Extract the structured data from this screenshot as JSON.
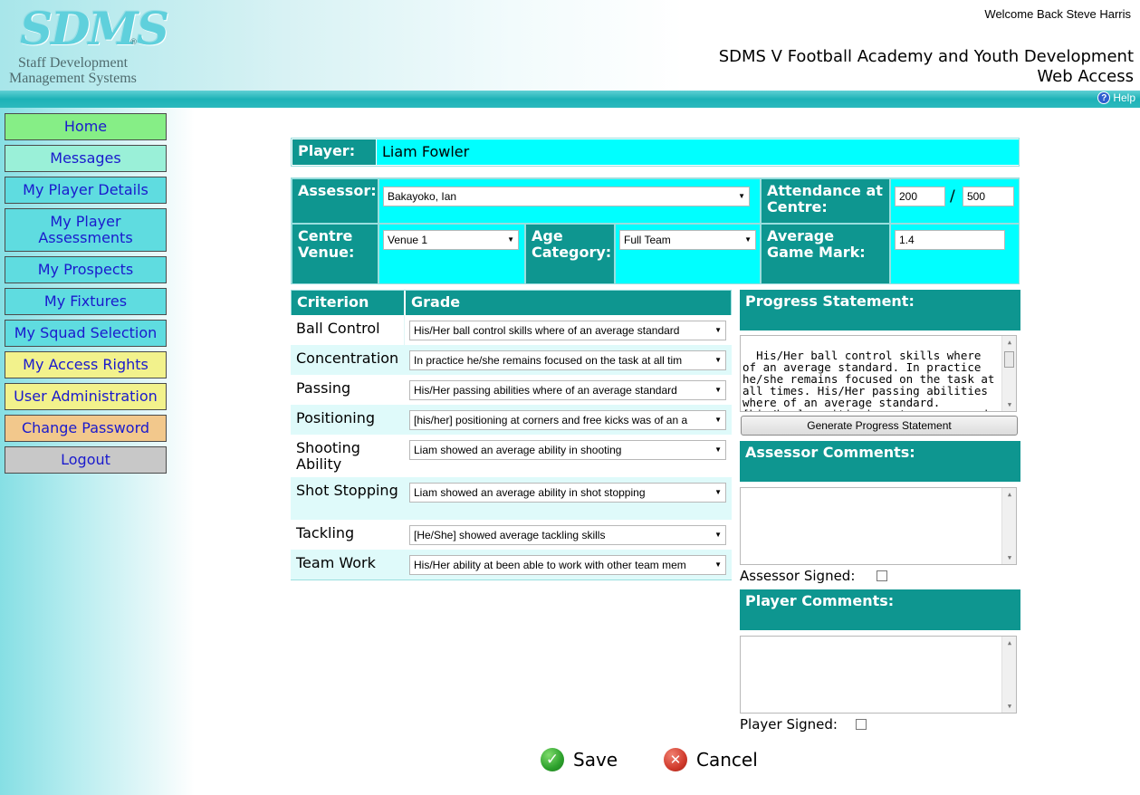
{
  "header": {
    "logo": "SDMS",
    "logo_reg": "®",
    "logo_line1": "Staff Development",
    "logo_line2": "Management Systems",
    "welcome": "Welcome Back Steve Harris",
    "title_line1": "SDMS V Football Academy and Youth Development",
    "title_line2": "Web Access",
    "help_label": "Help",
    "help_icon": "?"
  },
  "sidebar": {
    "items": [
      {
        "label": "Home",
        "color": "#86ee86"
      },
      {
        "label": "Messages",
        "color": "#9af0d8"
      },
      {
        "label": "My Player Details",
        "color": "#5fdce0"
      },
      {
        "label": "My Player Assessments",
        "color": "#5fdce0"
      },
      {
        "label": "My Prospects",
        "color": "#5fdce0"
      },
      {
        "label": "My Fixtures",
        "color": "#5fdce0"
      },
      {
        "label": "My Squad Selection",
        "color": "#5fdce0"
      },
      {
        "label": "My Access Rights",
        "color": "#f2f28c"
      },
      {
        "label": "User Administration",
        "color": "#f2f28c"
      },
      {
        "label": "Change Password",
        "color": "#f2c88c"
      },
      {
        "label": "Logout",
        "color": "#c8c8c8"
      }
    ]
  },
  "player": {
    "label": "Player:",
    "name": "Liam Fowler"
  },
  "details": {
    "assessor_label": "Assessor:",
    "assessor_value": "Bakayoko, Ian",
    "attendance_label": "Attendance at Centre:",
    "attendance_value": "200",
    "attendance_sep": "/",
    "attendance_total": "500",
    "venue_label": "Centre Venue:",
    "venue_value": "Venue 1",
    "age_label": "Age Category:",
    "age_value": "Full Team",
    "avg_label": "Average Game Mark:",
    "avg_value": "1.4"
  },
  "criteria": {
    "col_criterion": "Criterion",
    "col_grade": "Grade",
    "rows": [
      {
        "name": "Ball Control",
        "grade": "His/Her ball control skills where of an average standard"
      },
      {
        "name": "Concentration",
        "grade": "In practice he/she remains focused on the task at all tim"
      },
      {
        "name": "Passing",
        "grade": "His/Her passing abilities where of an average standard"
      },
      {
        "name": "Positioning",
        "grade": "[his/her] positioning at corners and free kicks was of an a"
      },
      {
        "name": "Shooting Ability",
        "grade": "Liam showed an average ability in shooting"
      },
      {
        "name": "Shot Stopping",
        "grade": "Liam showed an average ability in shot stopping"
      },
      {
        "name": "Tackling",
        "grade": "[He/She] showed average tackling skills"
      },
      {
        "name": "Team Work",
        "grade": "His/Her ability at been able to work with other team mem"
      }
    ]
  },
  "progress": {
    "label": "Progress Statement:",
    "text": "His/Her ball control skills where of an average standard. In practice he/she remains focused on the task at all times. His/Her passing abilities where of an average standard. [his/her] positioning at corners and free",
    "generate_label": "Generate Progress Statement"
  },
  "assessor_comments": {
    "label": "Assessor Comments:",
    "text": "",
    "signed_label": "Assessor Signed:"
  },
  "player_comments": {
    "label": "Player Comments:",
    "text": "",
    "signed_label": "Player Signed:"
  },
  "actions": {
    "save_label": "Save",
    "cancel_label": "Cancel",
    "save_icon": "check-icon",
    "cancel_icon": "cross-icon"
  },
  "colors": {
    "teal": "#0e9690",
    "cyan": "#00ffff",
    "link_blue": "#1a1acd",
    "save_green": "#2ca02c",
    "cancel_red": "#d03a2c"
  }
}
